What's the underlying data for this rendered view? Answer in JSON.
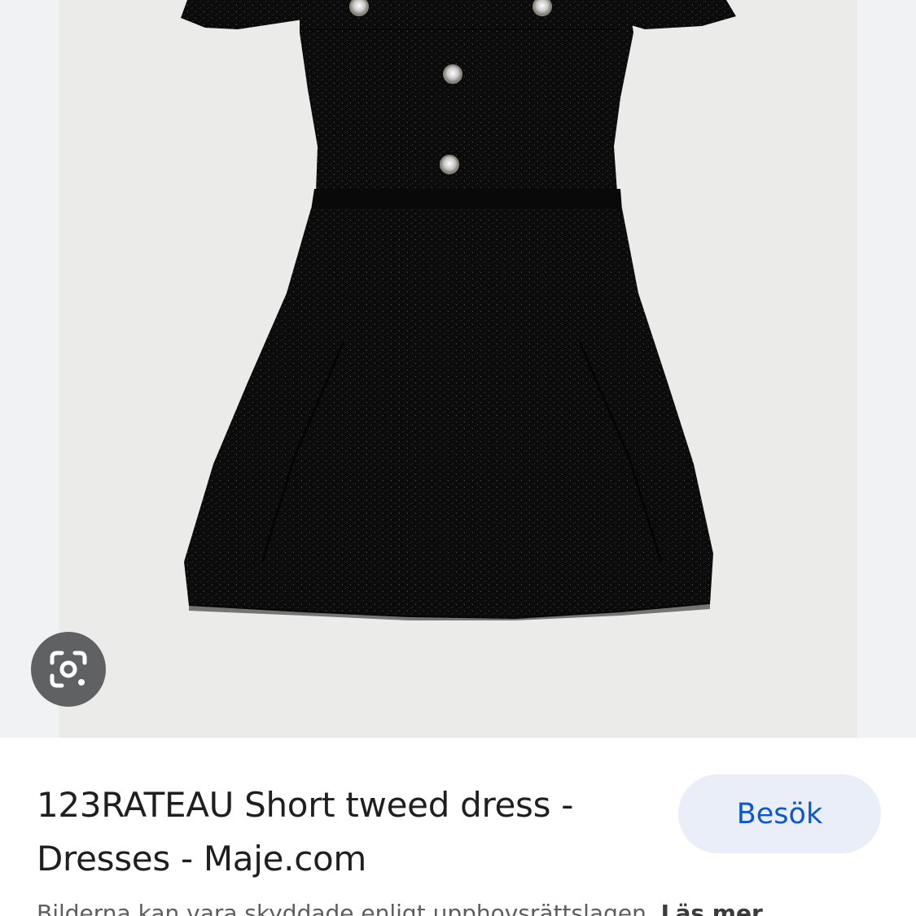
{
  "image": {
    "subject": "black tweed short-sleeve dress with jewel buttons",
    "background_color": "#ebebea",
    "dress_color": "#0b0b0b",
    "button_color": "#d8d8d8"
  },
  "lens_button": {
    "icon": "google-lens-icon"
  },
  "result": {
    "title": "123RATEAU Short tweed dress - Dresses - Maje.com",
    "visit_label": "Besök",
    "copyright_text": "Bilderna kan vara skyddade enligt upphovsrättslagen.",
    "learn_more_label": "Läs mer"
  },
  "colors": {
    "accent": "#0b57d0",
    "button_bg": "#e9eef9",
    "text": "#1f1f1f",
    "muted_text": "#5e5e5e"
  }
}
